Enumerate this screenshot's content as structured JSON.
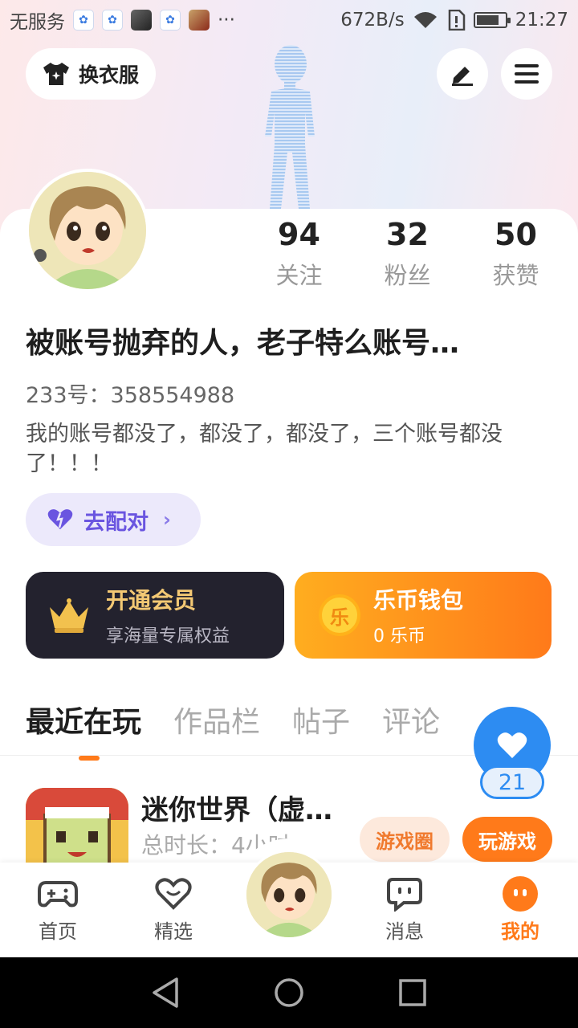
{
  "status_bar": {
    "carrier": "无服务",
    "speed": "672B/s",
    "time": "21:27",
    "more": "···",
    "battery_level": 0.75
  },
  "header": {
    "wardrobe_label": "换衣服"
  },
  "profile": {
    "stats": [
      {
        "num": "94",
        "label": "关注"
      },
      {
        "num": "32",
        "label": "粉丝"
      },
      {
        "num": "50",
        "label": "获赞"
      }
    ],
    "nickname": "被账号抛弃的人，老子特么账号…",
    "uid": "233号：358554988",
    "bio": "我的账号都没了，都没了，都没了，三个账号都没了！！！",
    "pair_label": "去配对"
  },
  "vip": {
    "title": "开通会员",
    "subtitle": "享海量专属权益"
  },
  "wallet": {
    "title": "乐币钱包",
    "subtitle": "0 乐币",
    "coin_glyph": "乐"
  },
  "tabs": [
    "最近在玩",
    "作品栏",
    "帖子",
    "评论"
  ],
  "favorite": {
    "count": "21"
  },
  "recent_game": {
    "name": "迷你世界（虚…",
    "duration": "总时长：4小时",
    "circle_label": "游戏圈",
    "play_label": "玩游戏"
  },
  "bottom_nav": [
    {
      "label": "首页"
    },
    {
      "label": "精选"
    },
    {
      "label": "消息"
    },
    {
      "label": "我的"
    }
  ],
  "colors": {
    "accent": "#ff7a1a",
    "pair": "#6a55e0",
    "favorite": "#2d8cf2"
  }
}
